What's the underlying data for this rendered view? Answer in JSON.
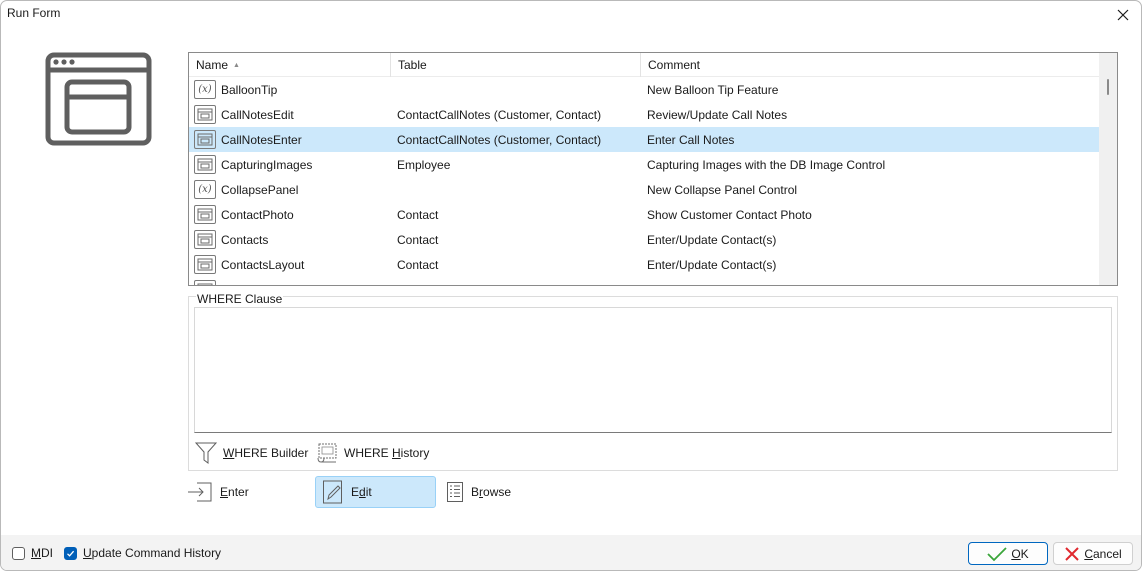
{
  "window": {
    "title": "Run Form",
    "close_icon": "close-icon",
    "form_icon": "form-window-icon"
  },
  "grid": {
    "columns": [
      {
        "label": "Name",
        "sort": "ascending"
      },
      {
        "label": "Table"
      },
      {
        "label": "Comment"
      }
    ],
    "rows": [
      {
        "icon": "function-icon",
        "name": "BalloonTip",
        "table": "",
        "comment": "New Balloon Tip Feature",
        "selected": false
      },
      {
        "icon": "form-icon",
        "name": "CallNotesEdit",
        "table": "ContactCallNotes (Customer, Contact)",
        "comment": "Review/Update Call Notes",
        "selected": false
      },
      {
        "icon": "form-icon",
        "name": "CallNotesEnter",
        "table": "ContactCallNotes (Customer, Contact)",
        "comment": "Enter Call Notes",
        "selected": true
      },
      {
        "icon": "form-icon",
        "name": "CapturingImages",
        "table": "Employee",
        "comment": "Capturing Images with the DB Image Control",
        "selected": false
      },
      {
        "icon": "function-icon",
        "name": "CollapsePanel",
        "table": "",
        "comment": "New Collapse Panel Control",
        "selected": false
      },
      {
        "icon": "form-icon",
        "name": "ContactPhoto",
        "table": "Contact",
        "comment": "Show Customer Contact Photo",
        "selected": false
      },
      {
        "icon": "form-icon",
        "name": "Contacts",
        "table": "Contact",
        "comment": "Enter/Update Contact(s)",
        "selected": false
      },
      {
        "icon": "form-icon",
        "name": "ContactsLayout",
        "table": "Contact",
        "comment": "Enter/Update Contact(s)",
        "selected": false
      }
    ],
    "selection_color": "#cce8fb"
  },
  "where": {
    "group_label": "WHERE Clause",
    "value": "",
    "builder": {
      "mnemonic": "W",
      "rest": "HERE Builder",
      "icon": "funnel-icon"
    },
    "history": {
      "before": "WHERE ",
      "mnemonic": "H",
      "rest": "istory",
      "icon": "history-scroll-icon"
    }
  },
  "actions": {
    "enter": {
      "mnemonic": "E",
      "rest": "nter",
      "icon": "enter-arrow-icon",
      "active": false
    },
    "edit": {
      "before": "E",
      "mnemonic": "d",
      "rest": "it",
      "icon": "edit-pencil-icon",
      "active": true
    },
    "browse": {
      "before": "B",
      "mnemonic": "r",
      "rest": "owse",
      "icon": "browse-list-icon",
      "active": false
    }
  },
  "footer": {
    "mdi": {
      "mnemonic": "M",
      "rest": "DI",
      "checked": false
    },
    "update_history": {
      "mnemonic": "U",
      "rest": "pdate Command History",
      "checked": true
    },
    "ok": {
      "mnemonic": "O",
      "rest": "K",
      "icon": "checkmark-icon"
    },
    "cancel": {
      "mnemonic": "C",
      "rest": "ancel",
      "icon": "cross-icon"
    }
  },
  "colors": {
    "accent": "#005fb8",
    "ok_check": "#3aa53a",
    "cancel_cross": "#e0282e"
  }
}
